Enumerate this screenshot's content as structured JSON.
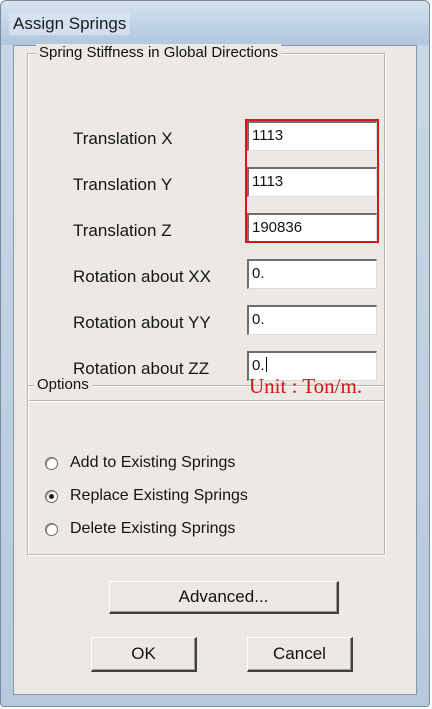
{
  "window": {
    "title": "Assign Springs"
  },
  "stiffness": {
    "group_title": "Spring Stiffness in Global Directions",
    "fields": [
      {
        "label": "Translation X",
        "value": "1113"
      },
      {
        "label": "Translation Y",
        "value": "1113"
      },
      {
        "label": "Translation Z",
        "value": "190836"
      },
      {
        "label": "Rotation about XX",
        "value": "0."
      },
      {
        "label": "Rotation about YY",
        "value": "0."
      },
      {
        "label": "Rotation about ZZ",
        "value": "0."
      }
    ]
  },
  "annotation": {
    "unit_note": "Unit : Ton/m.",
    "highlight_color": "#d9141b"
  },
  "options": {
    "group_title": "Options",
    "choices": [
      {
        "label": "Add to Existing Springs",
        "checked": false
      },
      {
        "label": "Replace Existing Springs",
        "checked": true
      },
      {
        "label": "Delete Existing Springs",
        "checked": false
      }
    ]
  },
  "buttons": {
    "advanced": "Advanced...",
    "ok": "OK",
    "cancel": "Cancel"
  }
}
